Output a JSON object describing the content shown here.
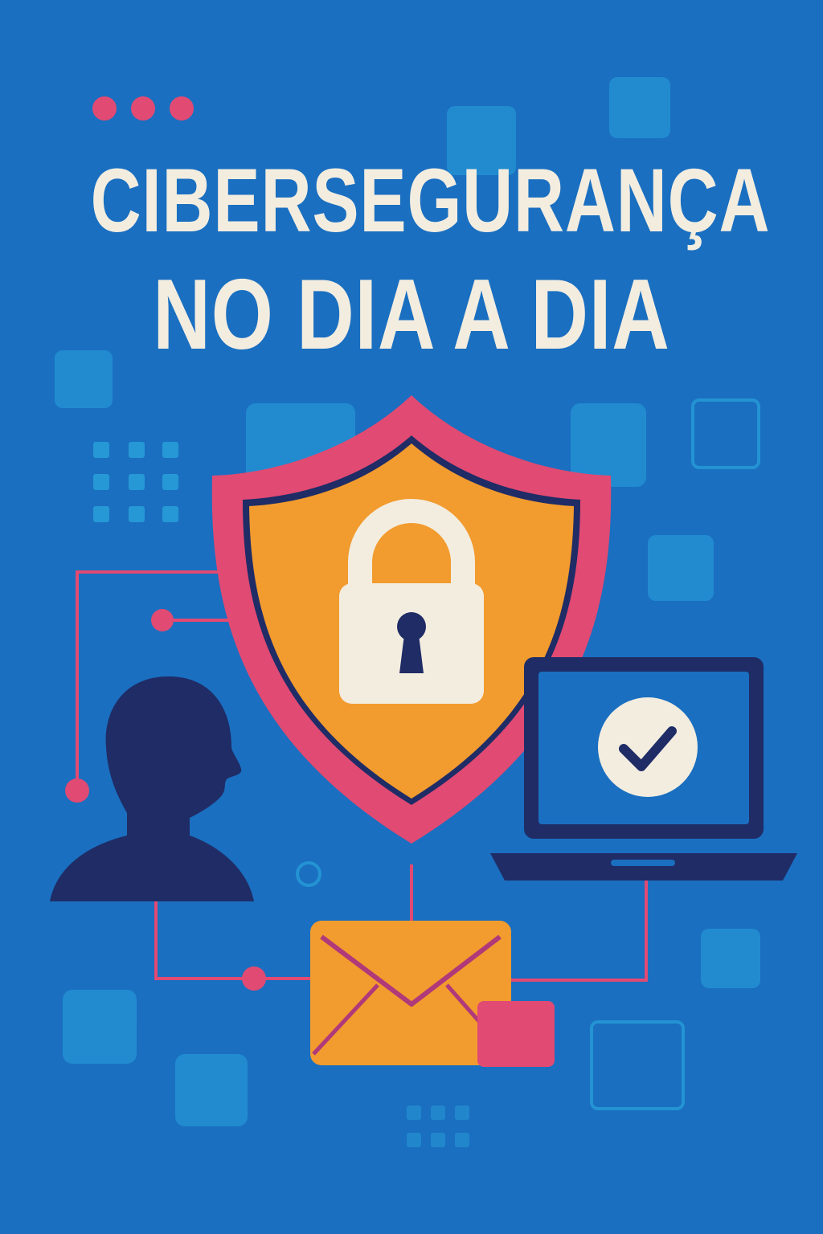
{
  "poster": {
    "title_line1": "CIBERSEGURANÇA",
    "title_line2": "NO DIA A DIA"
  },
  "colors": {
    "background": "#1a6fc0",
    "title": "#f3ede0",
    "shield_outer": "#e14a72",
    "shield_inner": "#f29b2e",
    "navy": "#1f2c66",
    "accent_pink": "#e14a72",
    "light_square": "#2aa3dc"
  },
  "icons": [
    "padlock-icon",
    "shield-icon",
    "person-icon",
    "laptop-icon",
    "checkmark-icon",
    "envelope-icon"
  ]
}
